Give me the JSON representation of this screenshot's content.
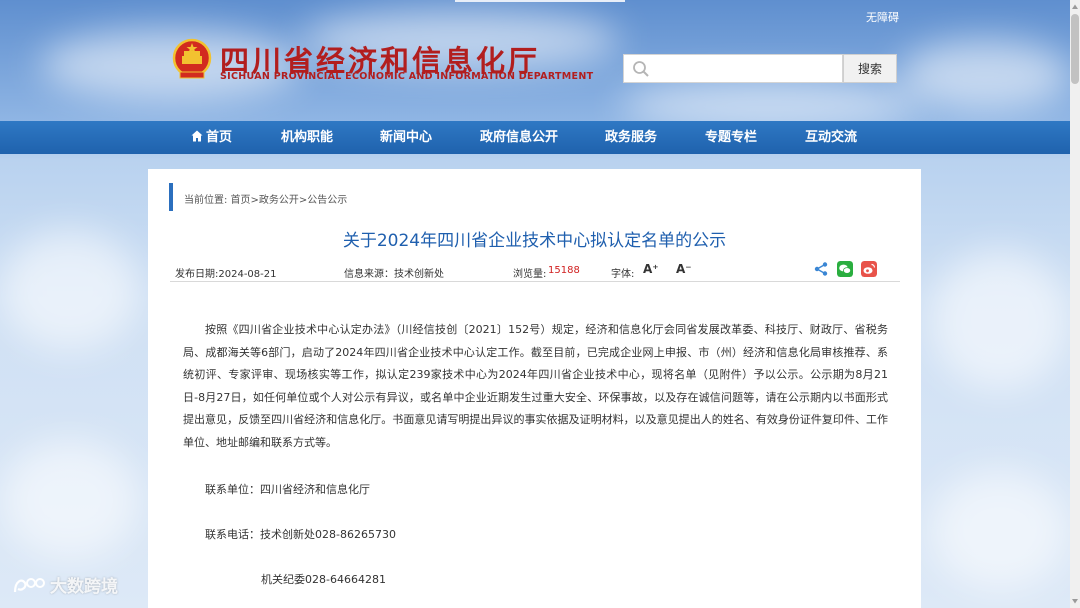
{
  "header": {
    "accessibility": "无障碍",
    "logo_cn": "四川省经济和信息化厅",
    "logo_en": "SICHUAN PROVINCIAL ECONOMIC AND INFORMATION DEPARTMENT",
    "search_placeholder": "",
    "search_button": "搜索"
  },
  "nav": {
    "items": [
      {
        "label": "首页"
      },
      {
        "label": "机构职能"
      },
      {
        "label": "新闻中心"
      },
      {
        "label": "政府信息公开"
      },
      {
        "label": "政务服务"
      },
      {
        "label": "专题专栏"
      },
      {
        "label": "互动交流"
      }
    ]
  },
  "article": {
    "breadcrumb": "当前位置: 首页>政务公开>公告公示",
    "title": "关于2024年四川省企业技术中心拟认定名单的公示",
    "meta": {
      "date": "发布日期:2024-08-21",
      "source": "信息来源：技术创新处",
      "views_label": "浏览量:",
      "views": "15188",
      "font_label": "字体:",
      "font_up": "A⁺",
      "font_down": "A⁻"
    },
    "paragraph": "按照《四川省企业技术中心认定办法》（川经信技创〔2021〕152号）规定，经济和信息化厅会同省发展改革委、科技厅、财政厅、省税务局、成都海关等6部门，启动了2024年四川省企业技术中心认定工作。截至目前，已完成企业网上申报、市（州）经济和信息化局审核推荐、系统初评、专家评审、现场核实等工作，拟认定239家技术中心为2024年四川省企业技术中心，现将名单（见附件）予以公示。公示期为8月21日-8月27日，如任何单位或个人对公示有异议，或名单中企业近期发生过重大安全、环保事故，以及存在诚信问题等，请在公示期内以书面形式提出意见，反馈至四川省经济和信息化厅。书面意见请写明提出异议的事实依据及证明材料，以及意见提出人的姓名、有效身份证件复印件、工作单位、地址邮编和联系方式等。",
    "contact_unit": "联系单位：四川省经济和信息化厅",
    "contact_phone": "联系电话：技术创新处028-86265730",
    "contact_phone2": "机关纪委028-64664281"
  },
  "watermark": "大数跨境",
  "colors": {
    "nav_bg": "#1f62ad",
    "title": "#1f5fae",
    "logo": "#b21e1e",
    "views": "#d02020"
  }
}
